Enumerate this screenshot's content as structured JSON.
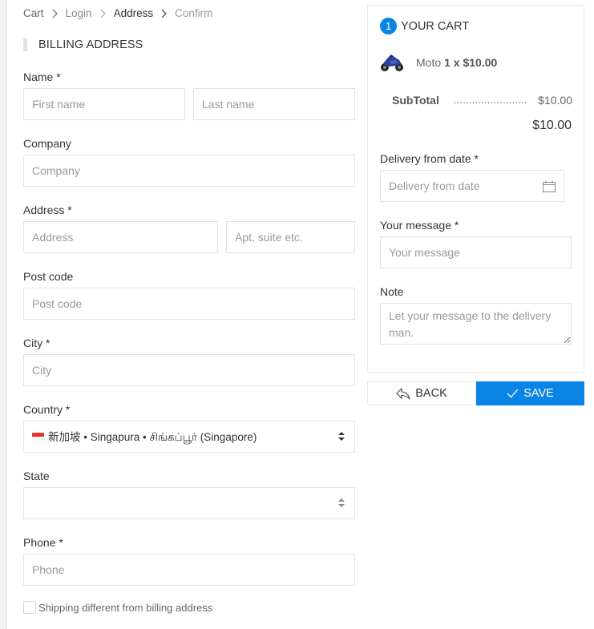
{
  "breadcrumb": [
    {
      "label": "Cart",
      "state": "first"
    },
    {
      "label": "Login",
      "state": "done"
    },
    {
      "label": "Address",
      "state": "active"
    },
    {
      "label": "Confirm",
      "state": "pending"
    }
  ],
  "billing": {
    "title": "BILLING ADDRESS",
    "name_label": "Name *",
    "first_name_placeholder": "First name",
    "last_name_placeholder": "Last name",
    "company_label": "Company",
    "company_placeholder": "Company",
    "address_label": "Address *",
    "address_placeholder": "Address",
    "apt_placeholder": "Apt, suite etc.",
    "postcode_label": "Post code",
    "postcode_placeholder": "Post code",
    "city_label": "City *",
    "city_placeholder": "City",
    "country_label": "Country *",
    "country_value": "新加坡 • Singapura • சிங்கப்பூர் (Singapore)",
    "country_flag": "singapore-flag",
    "state_label": "State",
    "state_value": "",
    "phone_label": "Phone *",
    "phone_placeholder": "Phone",
    "shipping_checkbox_label": "Shipping different from billing address",
    "shipping_checked": false
  },
  "cart": {
    "badge_count": "1",
    "title": "YOUR CART",
    "items": [
      {
        "name": "Moto",
        "qty_price": "1 x $10.00",
        "icon": "motorcycle-image"
      }
    ],
    "subtotal_label": "SubTotal",
    "subtotal_dots": "........................",
    "subtotal_value": "$10.00",
    "total_value": "$10.00",
    "delivery_label": "Delivery from date *",
    "delivery_placeholder": "Delivery from date",
    "message_label": "Your message *",
    "message_placeholder": "Your message",
    "note_label": "Note",
    "note_placeholder": "Let your message to the delivery man."
  },
  "actions": {
    "back_label": "BACK",
    "save_label": "SAVE"
  },
  "colors": {
    "accent": "#0a84e5",
    "border": "#e2e2e2",
    "placeholder": "#999999"
  }
}
